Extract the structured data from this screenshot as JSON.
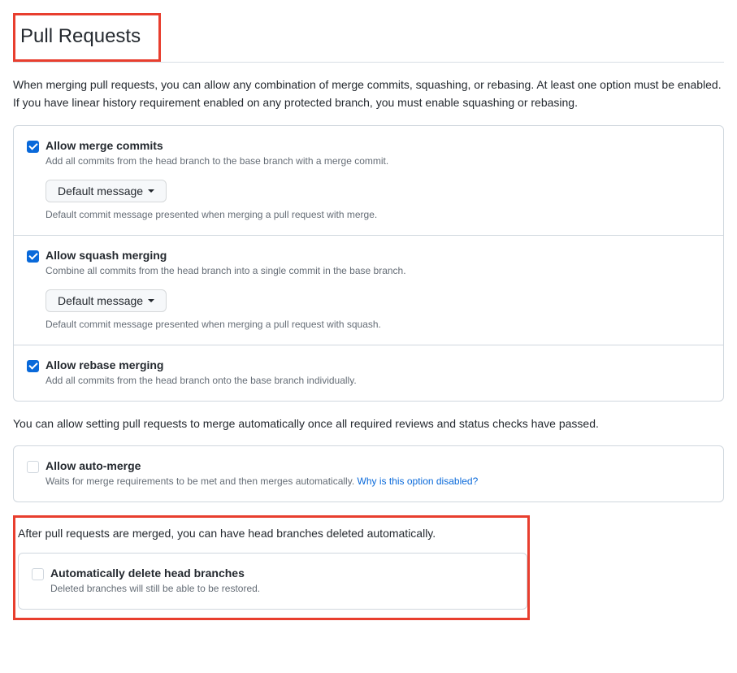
{
  "title": "Pull Requests",
  "intro": "When merging pull requests, you can allow any combination of merge commits, squashing, or rebasing. At least one option must be enabled. If you have linear history requirement enabled on any protected branch, you must enable squashing or rebasing.",
  "merge_options": [
    {
      "checked": true,
      "label": "Allow merge commits",
      "desc": "Add all commits from the head branch to the base branch with a merge commit.",
      "dropdown": "Default message",
      "dropdown_note": "Default commit message presented when merging a pull request with merge."
    },
    {
      "checked": true,
      "label": "Allow squash merging",
      "desc": "Combine all commits from the head branch into a single commit in the base branch.",
      "dropdown": "Default message",
      "dropdown_note": "Default commit message presented when merging a pull request with squash."
    },
    {
      "checked": true,
      "label": "Allow rebase merging",
      "desc": "Add all commits from the head branch onto the base branch individually."
    }
  ],
  "auto_merge_intro": "You can allow setting pull requests to merge automatically once all required reviews and status checks have passed.",
  "auto_merge": {
    "checked": false,
    "label": "Allow auto-merge",
    "desc": "Waits for merge requirements to be met and then merges automatically. ",
    "link_text": "Why is this option disabled?"
  },
  "auto_delete_intro": "After pull requests are merged, you can have head branches deleted automatically.",
  "auto_delete": {
    "checked": false,
    "label": "Automatically delete head branches",
    "desc": "Deleted branches will still be able to be restored."
  }
}
